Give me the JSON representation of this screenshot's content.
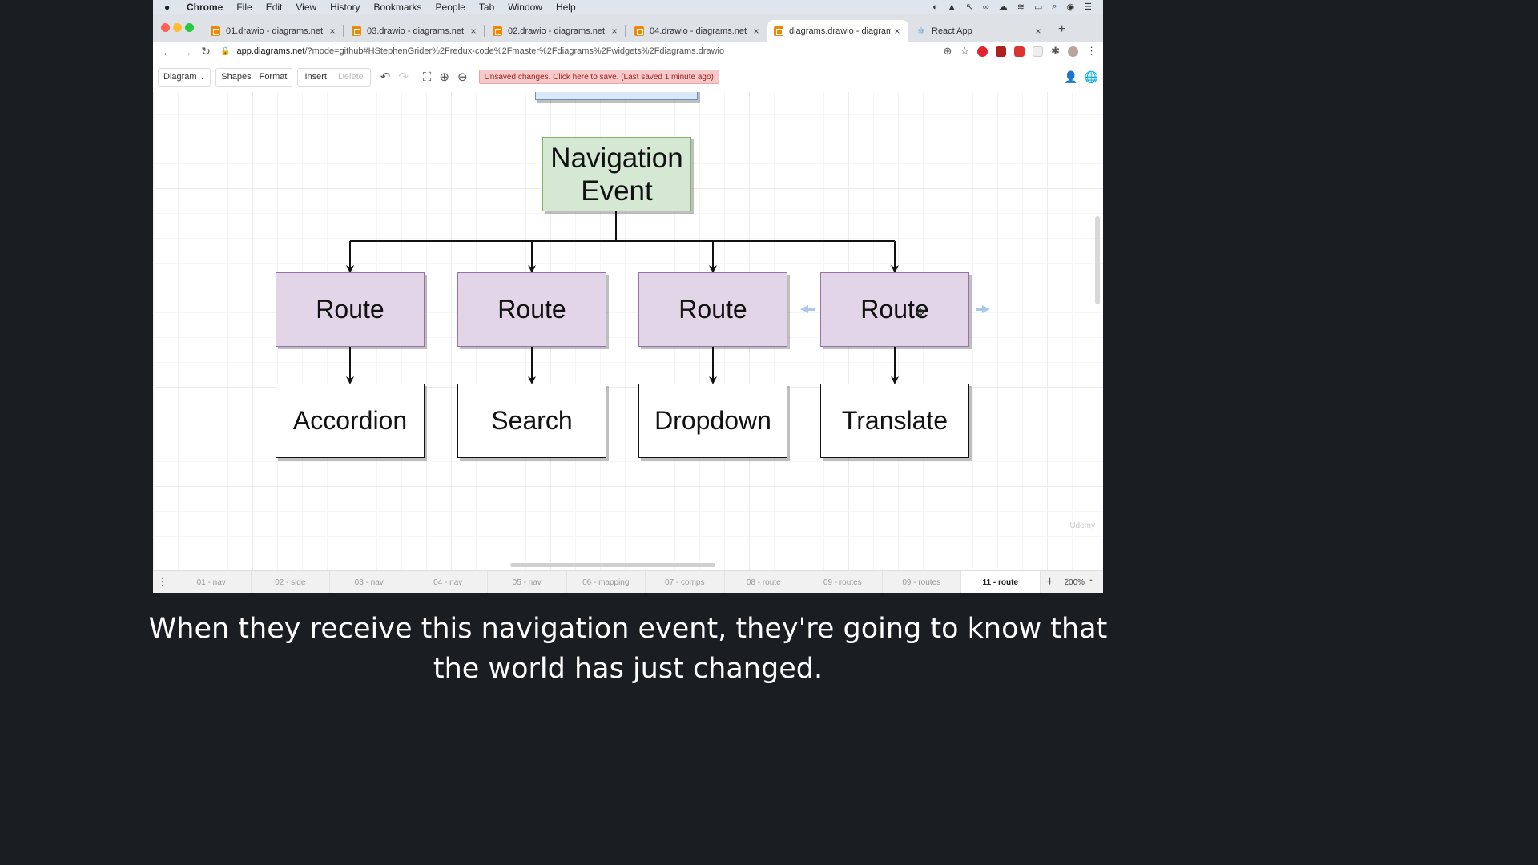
{
  "menubar": {
    "app": "Chrome",
    "items": [
      "File",
      "Edit",
      "View",
      "History",
      "Bookmarks",
      "People",
      "Tab",
      "Window",
      "Help"
    ]
  },
  "tabs": [
    {
      "label": "01.drawio - diagrams.net",
      "close": "×"
    },
    {
      "label": "03.drawio - diagrams.net",
      "close": "×"
    },
    {
      "label": "02.drawio - diagrams.net",
      "close": "×"
    },
    {
      "label": "04.drawio - diagrams.net",
      "close": "×"
    },
    {
      "label": "diagrams.drawio - diagrams.net",
      "close": "×"
    },
    {
      "label": "React App",
      "close": "×"
    }
  ],
  "address": {
    "host": "app.diagrams.net",
    "path": "/?mode=github#HStephenGrider%2Fredux-code%2Fmaster%2Fdiagrams%2Fwidgets%2Fdiagrams.drawio"
  },
  "toolbar": {
    "diagram": "Diagram",
    "shapes": "Shapes",
    "format": "Format",
    "insert": "Insert",
    "delete": "Delete",
    "unsaved": "Unsaved changes. Click here to save. (Last saved 1 minute ago)"
  },
  "diagram": {
    "root": {
      "line1": "Navigation",
      "line2": "Event"
    },
    "routes": [
      "Route",
      "Route",
      "Route",
      "Route"
    ],
    "components": [
      "Accordion",
      "Search",
      "Dropdown",
      "Translate"
    ]
  },
  "pages": [
    "01 - nav",
    "02 - side",
    "03 - nav",
    "04 - nav",
    "05 - nav",
    "06 - mapping",
    "07 - comps",
    "08 - route",
    "09 - routes",
    "09 - routes",
    "11 - route"
  ],
  "active_page": "11 - route",
  "zoom": "200%",
  "caption": {
    "line1": "When they receive this navigation event, they're going to know that",
    "line2": "the world has just changed."
  }
}
